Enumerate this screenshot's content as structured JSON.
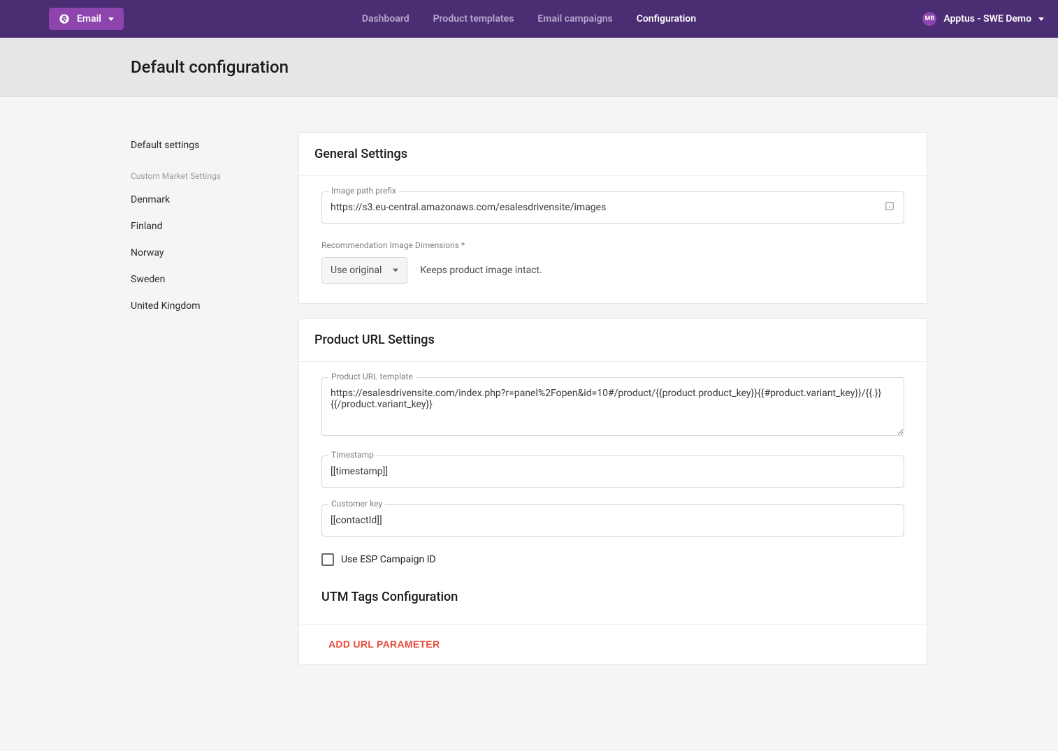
{
  "topbar": {
    "brand_label": "Email",
    "nav": {
      "dashboard": "Dashboard",
      "product_templates": "Product templates",
      "email_campaigns": "Email campaigns",
      "configuration": "Configuration"
    },
    "user": {
      "initials": "MB",
      "name": "Apptus - SWE Demo"
    }
  },
  "page_title": "Default configuration",
  "sidebar": {
    "default_settings": "Default settings",
    "group_label": "Custom Market Settings",
    "markets": {
      "denmark": "Denmark",
      "finland": "Finland",
      "norway": "Norway",
      "sweden": "Sweden",
      "uk": "United Kingdom"
    }
  },
  "general": {
    "title": "General Settings",
    "image_path_prefix_label": "Image path prefix",
    "image_path_prefix_value": "https://s3.eu-central.amazonaws.com/esalesdrivensite/images",
    "rec_dim_label": "Recommendation Image Dimensions *",
    "rec_dim_value": "Use original",
    "rec_dim_help": "Keeps product image intact."
  },
  "product_url": {
    "title": "Product URL Settings",
    "template_label": "Product URL template",
    "template_value": "https://esalesdrivensite.com/index.php?r=panel%2Fopen&id=10#/product/{{product.product_key}}{{#product.variant_key}}/{{.}}{{/product.variant_key}}",
    "timestamp_label": "Timestamp",
    "timestamp_value": "[[timestamp]]",
    "customer_key_label": "Customer key",
    "customer_key_value": "[[contactId]]",
    "use_esp_label": "Use ESP Campaign ID"
  },
  "utm": {
    "title": "UTM Tags Configuration",
    "add_button": "ADD URL PARAMETER"
  }
}
